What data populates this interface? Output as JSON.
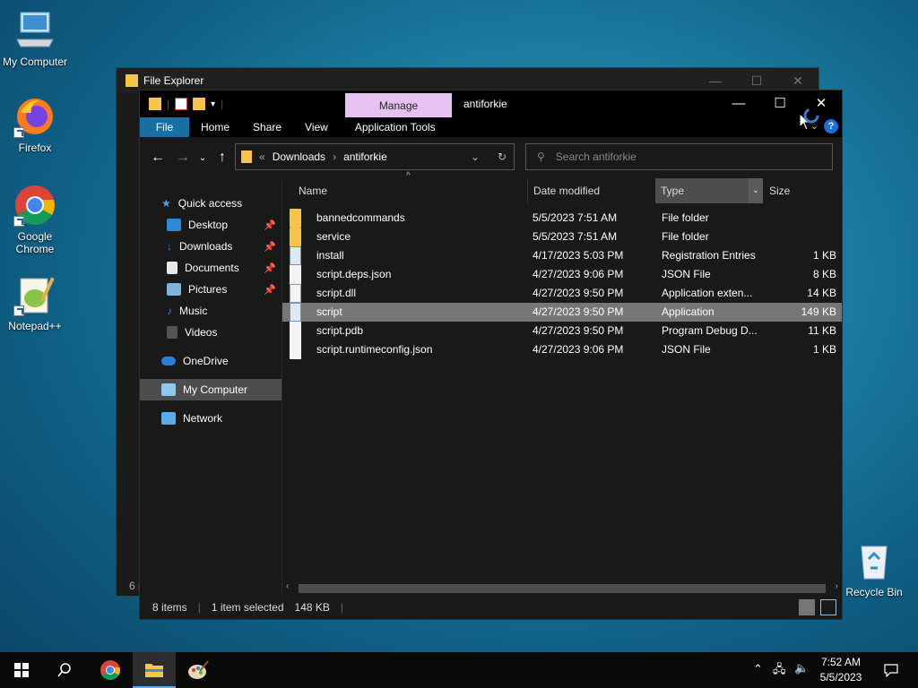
{
  "desktop": {
    "icons": [
      {
        "label": "My Computer"
      },
      {
        "label": "Firefox"
      },
      {
        "label": "Google Chrome"
      },
      {
        "label": "Notepad++"
      },
      {
        "label": "Recycle Bin"
      }
    ]
  },
  "back_window": {
    "title": "File Explorer",
    "status_fragment": "6 i"
  },
  "window": {
    "title": "antiforkie",
    "manage_tab": "Manage",
    "ribbon_tabs": [
      "File",
      "Home",
      "Share",
      "View",
      "Application Tools"
    ],
    "help": "?"
  },
  "address": {
    "prefix": "«",
    "crumbs": [
      "Downloads",
      "antiforkie"
    ],
    "search_placeholder": "Search antiforkie"
  },
  "sidebar": {
    "items": [
      {
        "label": "Quick access",
        "icon": "star-icon"
      },
      {
        "label": "Desktop",
        "icon": "desktop-icon",
        "pinned": true
      },
      {
        "label": "Downloads",
        "icon": "download-icon",
        "pinned": true
      },
      {
        "label": "Documents",
        "icon": "documents-icon",
        "pinned": true
      },
      {
        "label": "Pictures",
        "icon": "pictures-icon",
        "pinned": true
      },
      {
        "label": "Music",
        "icon": "music-icon"
      },
      {
        "label": "Videos",
        "icon": "videos-icon"
      },
      {
        "label": "OneDrive",
        "icon": "cloud-icon"
      },
      {
        "label": "My Computer",
        "icon": "computer-icon"
      },
      {
        "label": "Network",
        "icon": "network-icon"
      }
    ]
  },
  "columns": {
    "name": "Name",
    "date": "Date modified",
    "type": "Type",
    "size": "Size"
  },
  "files": [
    {
      "name": "bannedcommands",
      "date": "5/5/2023 7:51 AM",
      "type": "File folder",
      "size": "",
      "kind": "folder"
    },
    {
      "name": "service",
      "date": "5/5/2023 7:51 AM",
      "type": "File folder",
      "size": "",
      "kind": "folder"
    },
    {
      "name": "install",
      "date": "4/17/2023 5:03 PM",
      "type": "Registration Entries",
      "size": "1 KB",
      "kind": "reg"
    },
    {
      "name": "script.deps.json",
      "date": "4/27/2023 9:06 PM",
      "type": "JSON File",
      "size": "8 KB",
      "kind": "file"
    },
    {
      "name": "script.dll",
      "date": "4/27/2023 9:50 PM",
      "type": "Application exten...",
      "size": "14 KB",
      "kind": "dll"
    },
    {
      "name": "script",
      "date": "4/27/2023 9:50 PM",
      "type": "Application",
      "size": "149 KB",
      "kind": "app",
      "selected": true
    },
    {
      "name": "script.pdb",
      "date": "4/27/2023 9:50 PM",
      "type": "Program Debug D...",
      "size": "11 KB",
      "kind": "file"
    },
    {
      "name": "script.runtimeconfig.json",
      "date": "4/27/2023 9:06 PM",
      "type": "JSON File",
      "size": "1 KB",
      "kind": "file"
    }
  ],
  "status": {
    "count": "8 items",
    "selected": "1 item selected",
    "size": "148 KB"
  },
  "taskbar": {
    "time": "7:52 AM",
    "date": "5/5/2023"
  },
  "colors": {
    "file_tab": "#1a6fa1",
    "manage_tab": "#e6c2f0",
    "selected_row": "#777777",
    "folder": "#f5c54a"
  }
}
